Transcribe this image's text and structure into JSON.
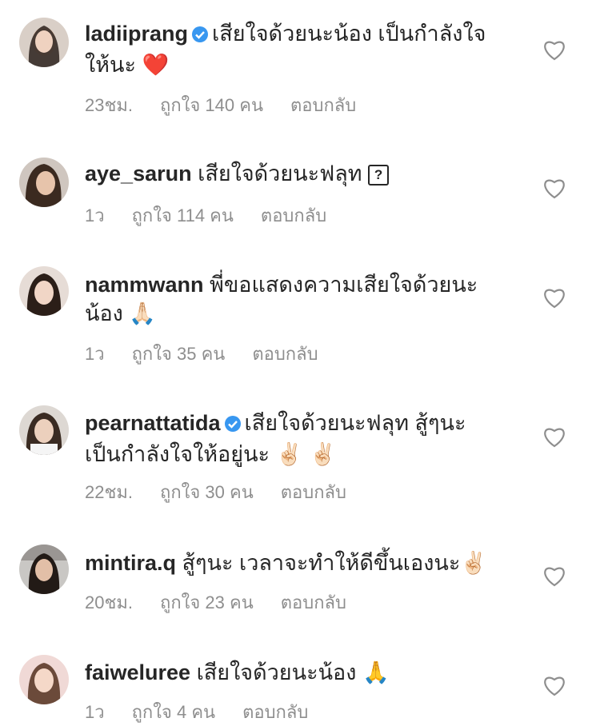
{
  "colors": {
    "text": "#262626",
    "meta": "#8e8e8e",
    "verified": "#3897f0",
    "heart_outline": "#8e8e8e"
  },
  "comments": [
    {
      "username": "ladiiprang",
      "verified": true,
      "text": "เสียใจด้วยนะน้อง เป็นกำลังใจให้นะ",
      "emoji": "❤️",
      "time": "23ชม.",
      "likes": "ถูกใจ 140 คน",
      "reply": "ตอบกลับ"
    },
    {
      "username": "aye_sarun",
      "verified": false,
      "text": "เสียใจด้วยนะฟลุท",
      "emoji": "?",
      "time": "1ว",
      "likes": "ถูกใจ 114 คน",
      "reply": "ตอบกลับ"
    },
    {
      "username": "nammwann",
      "verified": false,
      "text": "พี่ขอแสดงความเสียใจด้วยนะน้อง",
      "emoji": "🙏🏻",
      "time": "1ว",
      "likes": "ถูกใจ 35 คน",
      "reply": "ตอบกลับ"
    },
    {
      "username": "pearnattatida",
      "verified": true,
      "text": "เสียใจด้วยนะฟลุท สู้ๆนะ เป็นกำลังใจให้อยู่นะ",
      "emoji": "✌🏻 ✌🏻",
      "time": "22ชม.",
      "likes": "ถูกใจ 30 คน",
      "reply": "ตอบกลับ"
    },
    {
      "username": "mintira.q",
      "verified": false,
      "text": "สู้ๆนะ เวลาจะทำให้ดีขึ้นเองนะ",
      "emoji": "✌🏻",
      "time": "20ชม.",
      "likes": "ถูกใจ 23 คน",
      "reply": "ตอบกลับ"
    },
    {
      "username": "faiweluree",
      "verified": false,
      "text": "เสียใจด้วยนะน้อง",
      "emoji": "🙏",
      "time": "1ว",
      "likes": "ถูกใจ 4 คน",
      "reply": "ตอบกลับ"
    }
  ]
}
